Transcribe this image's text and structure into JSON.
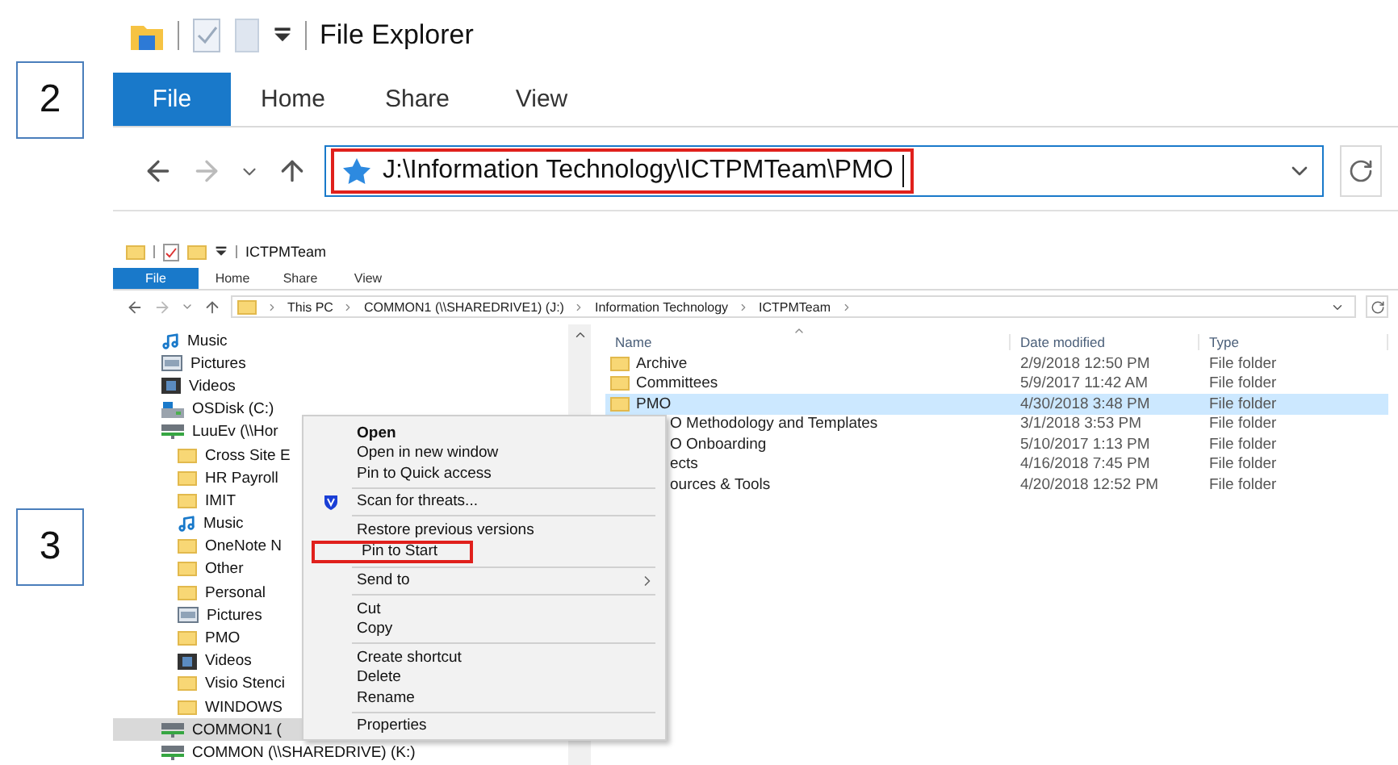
{
  "top_window": {
    "step": "2",
    "title": "File Explorer",
    "tabs": [
      {
        "label": "File",
        "selected": true
      },
      {
        "label": "Home",
        "selected": false
      },
      {
        "label": "Share",
        "selected": false
      },
      {
        "label": "View",
        "selected": false
      }
    ],
    "address": {
      "value": "J:\\Information Technology\\ICTPMTeam\\PMO",
      "highlighted": true
    }
  },
  "bottom_window": {
    "step": "3",
    "title": "ICTPMTeam",
    "tabs": [
      {
        "label": "File",
        "selected": true
      },
      {
        "label": "Home",
        "selected": false
      },
      {
        "label": "Share",
        "selected": false
      },
      {
        "label": "View",
        "selected": false
      }
    ],
    "breadcrumb": [
      "This PC",
      "COMMON1 (\\\\SHAREDRIVE1) (J:)",
      "Information Technology",
      "ICTPMTeam"
    ],
    "nav": [
      {
        "label": "Music",
        "kind": "music",
        "selected": false
      },
      {
        "label": "Pictures",
        "kind": "pictures",
        "selected": false
      },
      {
        "label": "Videos",
        "kind": "videos",
        "selected": false
      },
      {
        "label": "OSDisk (C:)",
        "kind": "disk",
        "selected": false
      },
      {
        "label": "LuuEv (\\\\Hor",
        "kind": "network",
        "selected": false,
        "children": [
          {
            "label": "Cross Site E",
            "kind": "folder",
            "selected": false
          },
          {
            "label": "HR Payroll",
            "kind": "folder",
            "selected": false
          },
          {
            "label": "IMIT",
            "kind": "folder",
            "selected": false
          },
          {
            "label": "Music",
            "kind": "music",
            "selected": false
          },
          {
            "label": "OneNote N",
            "kind": "folder",
            "selected": false
          },
          {
            "label": "Other",
            "kind": "folder",
            "selected": false
          },
          {
            "label": "Personal",
            "kind": "folder",
            "selected": false
          },
          {
            "label": "Pictures",
            "kind": "pictures",
            "selected": false
          },
          {
            "label": "PMO",
            "kind": "folder",
            "selected": false
          },
          {
            "label": "Videos",
            "kind": "videos",
            "selected": false
          },
          {
            "label": "Visio Stenci",
            "kind": "folder",
            "selected": false
          },
          {
            "label": "WINDOWS",
            "kind": "folder",
            "selected": false
          }
        ]
      },
      {
        "label": "COMMON1 (",
        "kind": "network",
        "selected": true
      },
      {
        "label": "COMMON (\\\\SHAREDRIVE) (K:)",
        "kind": "network",
        "selected": false
      }
    ],
    "columns": [
      "Name",
      "Date modified",
      "Type"
    ],
    "rows": [
      {
        "name": "Archive",
        "date": "2/9/2018 12:50 PM",
        "type": "File folder",
        "selected": false,
        "covered": false
      },
      {
        "name": "Committees",
        "date": "5/9/2017 11:42 AM",
        "type": "File folder",
        "selected": false,
        "covered": false
      },
      {
        "name": "PMO",
        "date": "4/30/2018 3:48 PM",
        "type": "File folder",
        "selected": true,
        "covered": false
      },
      {
        "name": "O Methodology and Templates",
        "date": "3/1/2018 3:53 PM",
        "type": "File folder",
        "selected": false,
        "covered": true
      },
      {
        "name": "O Onboarding",
        "date": "5/10/2017 1:13 PM",
        "type": "File folder",
        "selected": false,
        "covered": true
      },
      {
        "name": "ects",
        "date": "4/16/2018 7:45 PM",
        "type": "File folder",
        "selected": false,
        "covered": true
      },
      {
        "name": "ources & Tools",
        "date": "4/20/2018 12:52 PM",
        "type": "File folder",
        "selected": false,
        "covered": true
      }
    ]
  },
  "context_menu": {
    "items": [
      {
        "kind": "item",
        "label": "Open",
        "bold": true
      },
      {
        "kind": "item",
        "label": "Open in new window"
      },
      {
        "kind": "item",
        "label": "Pin to Quick access"
      },
      {
        "kind": "separator"
      },
      {
        "kind": "item",
        "label": "Scan for threats...",
        "shield": true
      },
      {
        "kind": "separator"
      },
      {
        "kind": "item",
        "label": "Restore previous versions"
      },
      {
        "kind": "item",
        "label": "Pin to Start",
        "highlighted": true
      },
      {
        "kind": "separator"
      },
      {
        "kind": "item",
        "label": "Send to",
        "submenu": true
      },
      {
        "kind": "separator"
      },
      {
        "kind": "item",
        "label": "Cut"
      },
      {
        "kind": "item",
        "label": "Copy"
      },
      {
        "kind": "separator"
      },
      {
        "kind": "item",
        "label": "Create shortcut"
      },
      {
        "kind": "item",
        "label": "Delete"
      },
      {
        "kind": "item",
        "label": "Rename"
      },
      {
        "kind": "separator"
      },
      {
        "kind": "item",
        "label": "Properties"
      }
    ]
  }
}
